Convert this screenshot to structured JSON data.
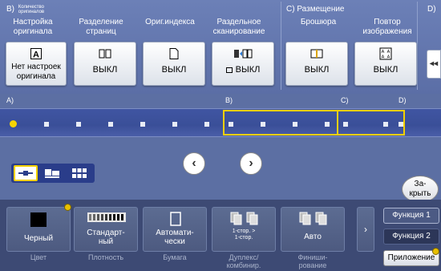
{
  "top_panel": {
    "group_b": {
      "label": "B)",
      "sub": "Количество оригиналов"
    },
    "group_c": {
      "label": "C)  Размещение"
    },
    "group_d": {
      "label": "D)"
    },
    "columns": [
      {
        "label": "Настройка оригинала",
        "value": "Нет настроек оригинала",
        "icon": "original-a-icon"
      },
      {
        "label": "Разделение страниц",
        "value": "ВЫКЛ",
        "icon": "book-split-icon"
      },
      {
        "label": "Ориг.индекса",
        "value": "ВЫКЛ",
        "icon": "index-page-icon"
      },
      {
        "label": "Раздельное сканирование",
        "value": "ВЫКЛ",
        "icon": "separate-scan-icon"
      },
      {
        "label": "Брошюра",
        "value": "ВЫКЛ",
        "icon": "booklet-icon"
      },
      {
        "label": "Повтор изображения",
        "value": "ВЫКЛ",
        "icon": "image-repeat-icon"
      }
    ],
    "collapse_symbol": "◂◂"
  },
  "map": {
    "section_labels": [
      "A)",
      "B)",
      "C)",
      "D)"
    ],
    "prev_symbol": "‹",
    "next_symbol": "›"
  },
  "close_button": {
    "label": "За-\nкрыть"
  },
  "bottom": {
    "tiles": [
      {
        "value": "Черный",
        "caption": "Цвет"
      },
      {
        "value": "Стандарт-\nный",
        "caption": "Плотность"
      },
      {
        "value": "Автомати-\nчески",
        "caption": "Бумага"
      },
      {
        "value": "1-стор. >\n1-стор.",
        "caption": "Дуплекс/\nкомбинир."
      },
      {
        "value": "Авто",
        "caption": "Финиши-\nрование"
      }
    ],
    "more_symbol": "›",
    "function1": "Функция 1",
    "function2": "Функция 2",
    "application": "Приложение"
  },
  "colors": {
    "accent": "#f3d000",
    "panel": "#5b6ea6",
    "track": "#3a4f98",
    "bottom": "#3d4a74"
  }
}
